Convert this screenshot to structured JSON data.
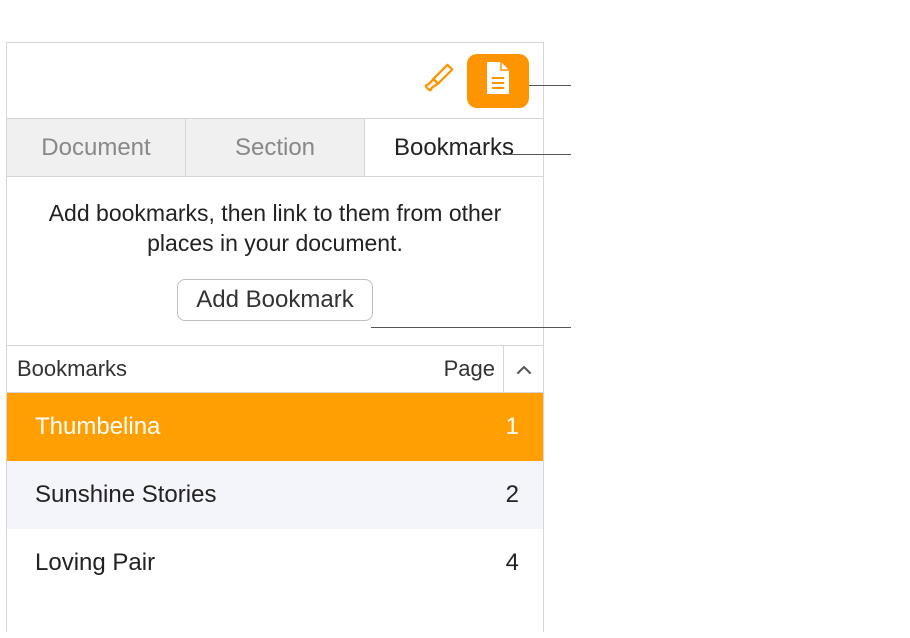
{
  "tabs": {
    "document": "Document",
    "section": "Section",
    "bookmarks": "Bookmarks"
  },
  "help_text": "Add bookmarks, then link to them from other places in your document.",
  "add_button": "Add Bookmark",
  "list_header": {
    "name": "Bookmarks",
    "page": "Page"
  },
  "rows": [
    {
      "name": "Thumbelina",
      "page": "1"
    },
    {
      "name": "Sunshine Stories",
      "page": "2"
    },
    {
      "name": "Loving Pair",
      "page": "4"
    }
  ]
}
